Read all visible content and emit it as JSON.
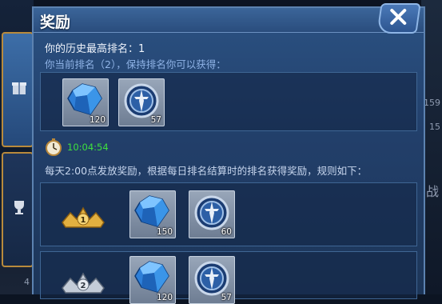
{
  "dialog": {
    "title": "奖励",
    "best_rank_label": "你的历史最高排名：1",
    "current_rank_label": "你当前排名（2），保持排名你可以获得：",
    "timer": "10:04:54",
    "description": "每天2:00点发放奖励，根据每日排名结算时的排名获得奖励，规则如下："
  },
  "current_rewards": [
    {
      "icon": "diamond-icon",
      "qty": "120"
    },
    {
      "icon": "medal-icon",
      "qty": "57"
    }
  ],
  "rank_rows": [
    {
      "rank": "1",
      "crown": "gold-crown-icon",
      "rewards": [
        {
          "icon": "diamond-icon",
          "qty": "150"
        },
        {
          "icon": "medal-icon",
          "qty": "60"
        }
      ]
    },
    {
      "rank": "2",
      "crown": "silver-crown-icon",
      "rewards": [
        {
          "icon": "diamond-icon",
          "qty": "120"
        },
        {
          "icon": "medal-icon",
          "qty": "57"
        }
      ]
    }
  ],
  "background": {
    "right_numbers": [
      "159",
      "15"
    ],
    "right_glyph": "战",
    "left_bottom_number": "4"
  },
  "colors": {
    "panel": "#2b5283",
    "timer_green": "#3ee03e",
    "blue_text": "#8fb3e6",
    "gold": "#d9a93a"
  }
}
